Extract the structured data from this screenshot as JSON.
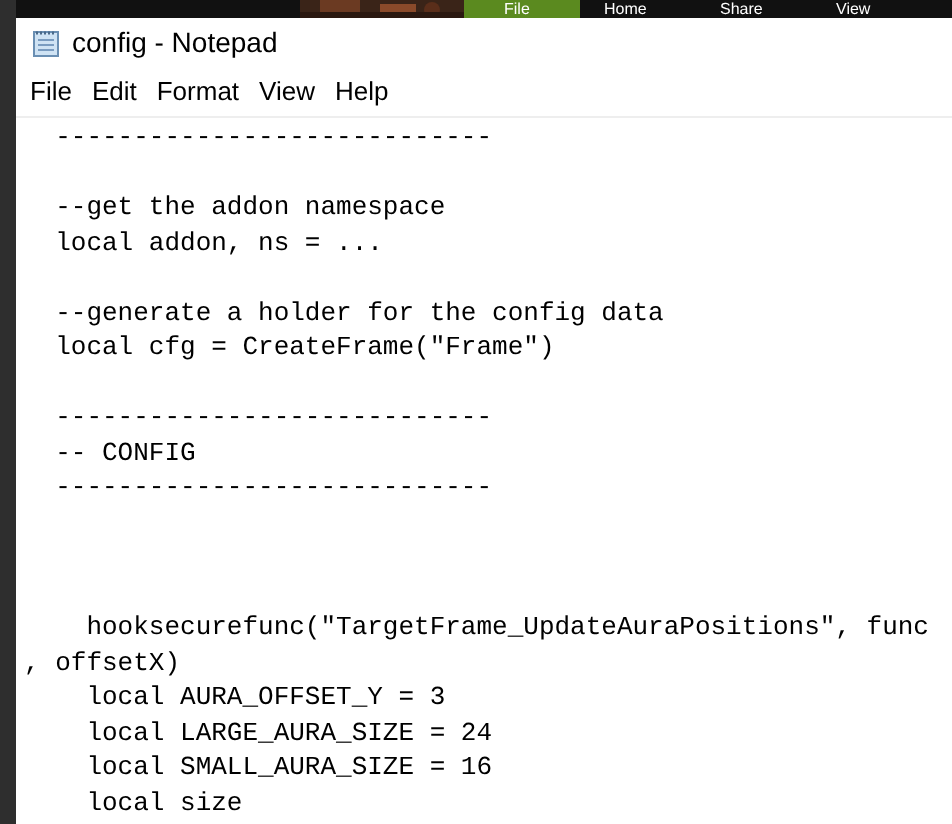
{
  "background_window": {
    "ribbon_tabs": [
      {
        "label": "File",
        "selected": true
      },
      {
        "label": "Home",
        "selected": false
      },
      {
        "label": "Share",
        "selected": false
      },
      {
        "label": "View",
        "selected": false
      }
    ]
  },
  "window": {
    "title": "config - Notepad"
  },
  "menu_bar": [
    "File",
    "Edit",
    "Format",
    "View",
    "Help"
  ],
  "editor": {
    "lines": [
      {
        "kind": "code",
        "text": "  ----------------------------"
      },
      {
        "kind": "blank"
      },
      {
        "kind": "code",
        "text": "  --get the addon namespace"
      },
      {
        "kind": "code",
        "text": "  local addon, ns = ..."
      },
      {
        "kind": "blank"
      },
      {
        "kind": "code",
        "text": "  --generate a holder for the config data"
      },
      {
        "kind": "code",
        "text": "  local cfg = CreateFrame(\"Frame\")"
      },
      {
        "kind": "blank"
      },
      {
        "kind": "code",
        "text": "  ----------------------------"
      },
      {
        "kind": "code",
        "text": "  -- CONFIG"
      },
      {
        "kind": "code",
        "text": "  ----------------------------"
      },
      {
        "kind": "blank"
      },
      {
        "kind": "blank"
      },
      {
        "kind": "blank"
      },
      {
        "kind": "code",
        "text": "    hooksecurefunc(\"TargetFrame_UpdateAuraPositions\", func"
      },
      {
        "kind": "code",
        "text": ", offsetX)"
      },
      {
        "kind": "code",
        "text": "    local AURA_OFFSET_Y = 3"
      },
      {
        "kind": "code",
        "text": "    local LARGE_AURA_SIZE = 24"
      },
      {
        "kind": "code",
        "text": "    local SMALL_AURA_SIZE = 16"
      },
      {
        "kind": "code",
        "text": "    local size"
      }
    ]
  }
}
